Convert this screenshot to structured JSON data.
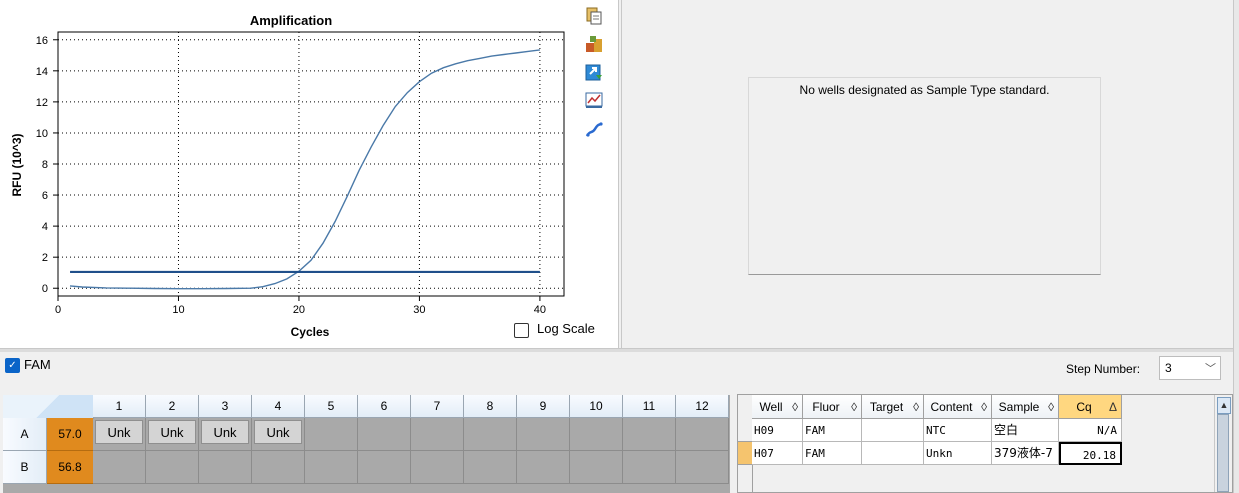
{
  "chart_data": {
    "type": "line",
    "title": "Amplification",
    "xlabel": "Cycles",
    "ylabel": "RFU (10^3)",
    "xlim": [
      0,
      42
    ],
    "ylim": [
      -0.5,
      16.5
    ],
    "xticks": [
      0,
      10,
      20,
      30,
      40
    ],
    "yticks": [
      0,
      2,
      4,
      6,
      8,
      10,
      12,
      14,
      16
    ],
    "grid": true,
    "series": [
      {
        "color": "#4a79a8",
        "x": [
          1,
          2,
          4,
          6,
          8,
          10,
          12,
          14,
          16,
          17,
          18,
          19,
          20,
          21,
          22,
          23,
          24,
          25,
          26,
          27,
          28,
          29,
          30,
          31,
          32,
          33,
          34,
          35,
          36,
          37,
          38,
          39,
          40
        ],
        "y": [
          0.15,
          0.08,
          0.02,
          0.0,
          -0.02,
          -0.03,
          -0.03,
          -0.02,
          0.0,
          0.1,
          0.3,
          0.6,
          1.1,
          1.8,
          2.9,
          4.3,
          5.9,
          7.6,
          9.1,
          10.5,
          11.7,
          12.6,
          13.3,
          13.85,
          14.2,
          14.45,
          14.65,
          14.8,
          14.95,
          15.05,
          15.15,
          15.25,
          15.35
        ]
      }
    ],
    "threshold": {
      "y": 1.05,
      "color": "#1f4f8a"
    }
  },
  "log_scale": {
    "label": "Log Scale",
    "checked": false
  },
  "toolbar_icons": [
    "copy-icon",
    "properties-icon",
    "export-icon",
    "chart-zoom-icon",
    "line-style-icon"
  ],
  "standard_curve": {
    "message": "No wells designated as Sample Type standard."
  },
  "fluor": {
    "label": "FAM",
    "checked": true
  },
  "step": {
    "label": "Step Number:",
    "value": "3"
  },
  "plate": {
    "columns": [
      "1",
      "2",
      "3",
      "4",
      "5",
      "6",
      "7",
      "8",
      "9",
      "10",
      "11",
      "12"
    ],
    "rows": [
      {
        "label": "A",
        "temp": "57.0",
        "wells": [
          "Unk",
          "Unk",
          "Unk",
          "Unk",
          "",
          "",
          "",
          "",
          "",
          "",
          "",
          ""
        ]
      },
      {
        "label": "B",
        "temp": "56.8",
        "wells": [
          "",
          "",
          "",
          "",
          "",
          "",
          "",
          "",
          "",
          "",
          "",
          ""
        ]
      }
    ]
  },
  "results": {
    "headers": [
      {
        "label": "Well",
        "sort": "◊"
      },
      {
        "label": "Fluor",
        "sort": "◊"
      },
      {
        "label": "Target",
        "sort": "◊"
      },
      {
        "label": "Content",
        "sort": "◊"
      },
      {
        "label": "Sample",
        "sort": "◊"
      },
      {
        "label": "Cq",
        "sort": "Δ"
      }
    ],
    "rows": [
      {
        "well": "H09",
        "fluor": "FAM",
        "target": "",
        "content": "NTC",
        "sample": "空白",
        "cq": "N/A"
      },
      {
        "well": "H07",
        "fluor": "FAM",
        "target": "",
        "content": "Unkn",
        "sample": "379液体-7",
        "cq": "20.18"
      }
    ]
  }
}
